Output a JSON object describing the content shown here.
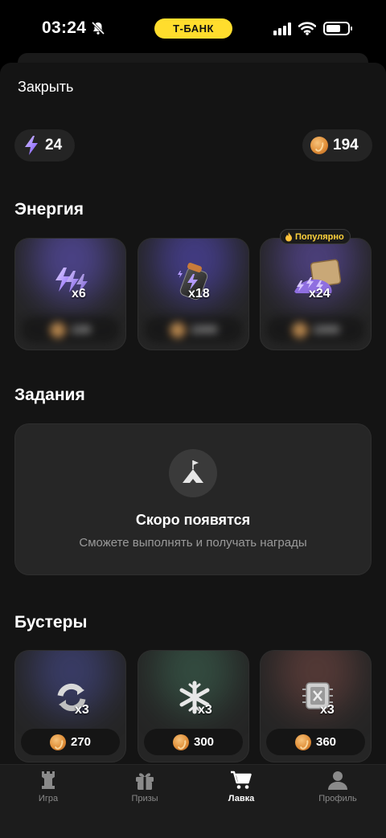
{
  "status_bar": {
    "time": "03:24",
    "carrier_badge": "Т-БАНК",
    "icons": [
      "bell-off-icon",
      "signal-icon",
      "wifi-icon",
      "battery-icon"
    ]
  },
  "header": {
    "close_label": "Закрыть"
  },
  "balance": {
    "energy": "24",
    "coins": "194"
  },
  "energy_section": {
    "title": "Энергия",
    "popular_badge": "Популярно",
    "items": [
      {
        "multiplier": "x6",
        "price": "100",
        "price_hidden": true,
        "icon": "lightning-pack-icon"
      },
      {
        "multiplier": "x18",
        "price": "1000",
        "price_hidden": true,
        "icon": "energy-jar-icon"
      },
      {
        "multiplier": "x24",
        "price": "1000",
        "price_hidden": true,
        "icon": "energy-chest-icon"
      }
    ]
  },
  "tasks_section": {
    "title": "Задания",
    "empty_title": "Скоро появятся",
    "empty_subtitle": "Сможете выполнять и получать награды",
    "icon": "mountain-flag-icon"
  },
  "boosters_section": {
    "title": "Бустеры",
    "items": [
      {
        "multiplier": "x3",
        "price": "270",
        "icon": "refresh-booster-icon"
      },
      {
        "multiplier": "x3",
        "price": "300",
        "icon": "snowflake-booster-icon"
      },
      {
        "multiplier": "x3",
        "price": "360",
        "icon": "chip-booster-icon"
      }
    ]
  },
  "tab_bar": {
    "active": "Лавка",
    "tabs": [
      {
        "label": "Игра",
        "icon": "chess-rook-icon"
      },
      {
        "label": "Призы",
        "icon": "gift-icon"
      },
      {
        "label": "Лавка",
        "icon": "cart-icon"
      },
      {
        "label": "Профиль",
        "icon": "user-icon"
      }
    ]
  },
  "colors": {
    "background": "#141414",
    "card": "#252525",
    "accent_yellow": "#ffdd2d",
    "energy_purple": "#9b7bff",
    "coin_orange": "#e1903a"
  }
}
